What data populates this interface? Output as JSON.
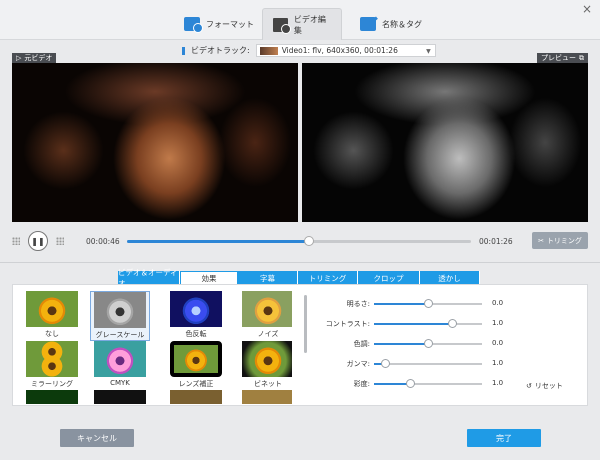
{
  "window": {
    "close_glyph": "×"
  },
  "top_tabs": [
    {
      "label": "フォーマット",
      "icon": "format-icon",
      "active": false
    },
    {
      "label": "ビデオ編集",
      "icon": "video-edit-icon",
      "active": true
    },
    {
      "label": "名称＆タグ",
      "icon": "tag-icon",
      "active": false
    }
  ],
  "track": {
    "label": "ビデオトラック:",
    "value": "Video1: flv, 640x360, 00:01:26"
  },
  "original_label": "元ビデオ",
  "preview_label": "プレビュー",
  "playback": {
    "current_time": "00:00:46",
    "total_time": "00:01:26",
    "progress": 0.53,
    "trim_label": "トリミング"
  },
  "subtabs": [
    {
      "label": "ビデオ＆オーディオ",
      "active": false
    },
    {
      "label": "効果",
      "active": true
    },
    {
      "label": "字幕",
      "active": false
    },
    {
      "label": "トリミング",
      "active": false
    },
    {
      "label": "クロップ",
      "active": false
    },
    {
      "label": "透かし",
      "active": false
    }
  ],
  "effects": [
    {
      "name": "なし",
      "style": "flower",
      "selected": false
    },
    {
      "name": "グレースケール",
      "style": "flower-gray",
      "selected": true
    },
    {
      "name": "色反転",
      "style": "flower-neg",
      "selected": false
    },
    {
      "name": "ノイズ",
      "style": "flower-noise",
      "selected": false
    },
    {
      "name": "ミラーリング",
      "style": "flower-mirror",
      "selected": false
    },
    {
      "name": "CMYK",
      "style": "flower-cmyk",
      "selected": false
    },
    {
      "name": "レンズ補正",
      "style": "flower-lens",
      "selected": false
    },
    {
      "name": "ビネット",
      "style": "flower-vig",
      "selected": false
    },
    {
      "name": "",
      "style": "flower-g",
      "selected": false
    },
    {
      "name": "",
      "style": "flower-b",
      "selected": false
    },
    {
      "name": "",
      "style": "flower-p",
      "selected": false
    },
    {
      "name": "",
      "style": "flower-o",
      "selected": false
    }
  ],
  "adjustments": [
    {
      "label": "明るさ:",
      "value": "0.0",
      "level": 0.5
    },
    {
      "label": "コントラスト:",
      "value": "1.0",
      "level": 0.72
    },
    {
      "label": "色調:",
      "value": "0.0",
      "level": 0.5
    },
    {
      "label": "ガンマ:",
      "value": "1.0",
      "level": 0.1
    },
    {
      "label": "彩度:",
      "value": "1.0",
      "level": 0.33
    }
  ],
  "reset_label": "リセット",
  "buttons": {
    "cancel": "キャンセル",
    "done": "完了"
  },
  "colors": {
    "accent": "#1f9be6",
    "slider": "#2d86d6"
  }
}
